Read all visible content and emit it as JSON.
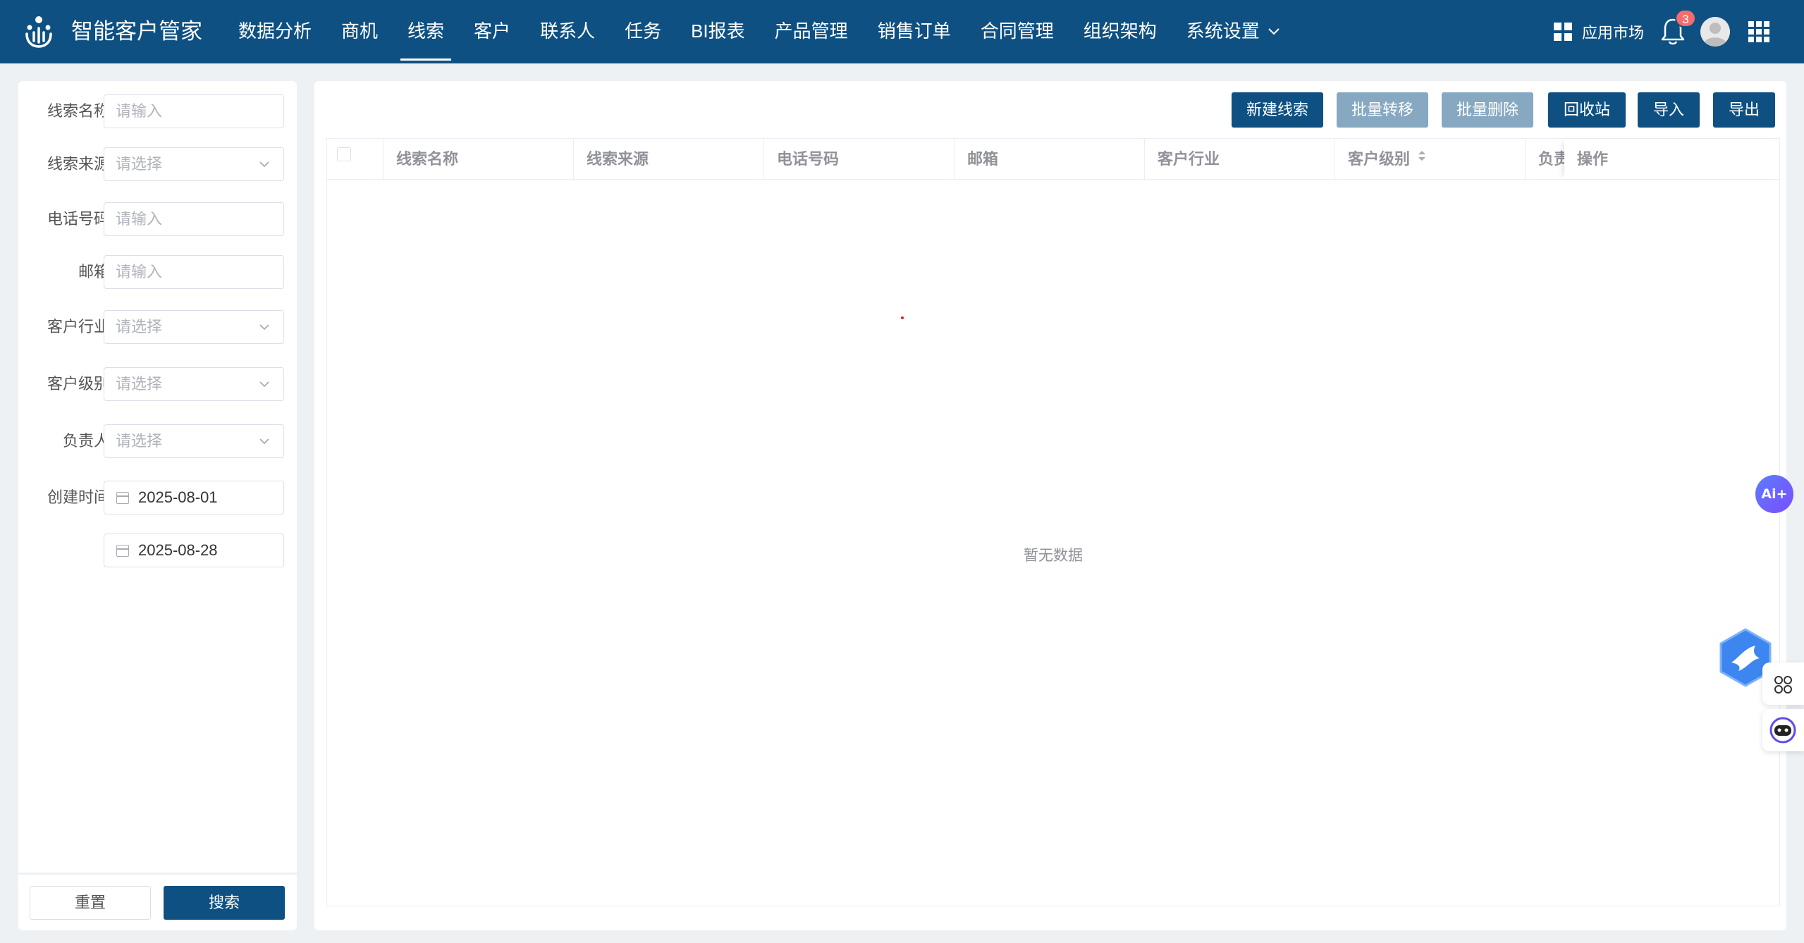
{
  "header": {
    "app_title": "智能客户管家",
    "nav": [
      "数据分析",
      "商机",
      "线索",
      "客户",
      "联系人",
      "任务",
      "BI报表",
      "产品管理",
      "销售订单",
      "合同管理",
      "组织架构",
      "系统设置"
    ],
    "active_nav": "线索",
    "market_label": "应用市场",
    "notification_count": "3"
  },
  "filters": {
    "clue_name": {
      "label": "线索名称",
      "placeholder": "请输入"
    },
    "clue_source": {
      "label": "线索来源",
      "placeholder": "请选择"
    },
    "phone": {
      "label": "电话号码",
      "placeholder": "请输入"
    },
    "email": {
      "label": "邮箱",
      "placeholder": "请输入"
    },
    "industry": {
      "label": "客户行业",
      "placeholder": "请选择"
    },
    "level": {
      "label": "客户级别",
      "placeholder": "请选择"
    },
    "owner": {
      "label": "负责人",
      "placeholder": "请选择"
    },
    "created": {
      "label": "创建时间",
      "start": "2025-08-01",
      "end": "2025-08-28"
    },
    "reset_label": "重置",
    "search_label": "搜索"
  },
  "toolbar": {
    "new_label": "新建线索",
    "batch_transfer_label": "批量转移",
    "batch_delete_label": "批量删除",
    "recycle_label": "回收站",
    "import_label": "导入",
    "export_label": "导出"
  },
  "table": {
    "columns": [
      "线索名称",
      "线索来源",
      "电话号码",
      "邮箱",
      "客户行业",
      "客户级别",
      "负责"
    ],
    "actions_header": "操作",
    "empty_text": "暂无数据"
  },
  "widgets": {
    "ai_label": "Ai+"
  },
  "colors": {
    "primary": "#0f5082",
    "primary_disabled": "#87a8c1",
    "badge": "#f56c6c",
    "page_bg": "#edf1f4"
  }
}
